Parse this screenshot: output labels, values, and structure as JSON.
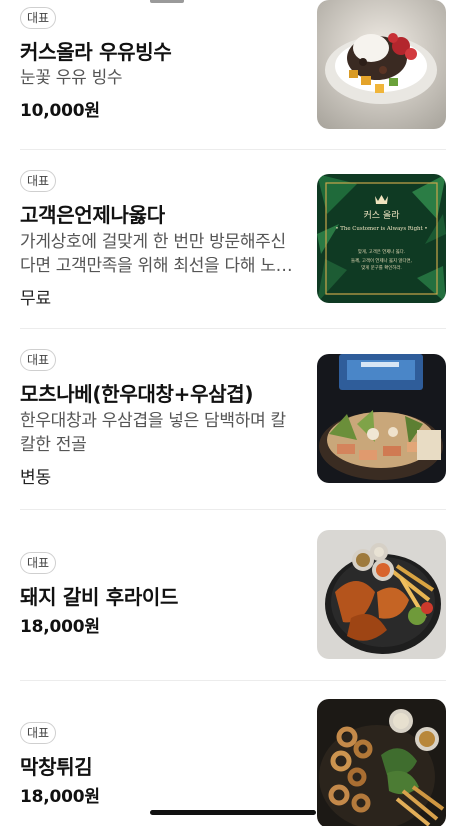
{
  "menu": {
    "items": [
      {
        "badge": "대표",
        "name": "커스올라 우유빙수",
        "description": "눈꽃 우유 빙수",
        "price": "10,000원",
        "image_icon": "bingsu-photo"
      },
      {
        "badge": "대표",
        "name": "고객은언제나옳다",
        "description": "가게상호에 걸맞게 한 번만 방문해주신다면 고객만족을 위해 최선을 다해 노력하겠습니다",
        "price": "무료",
        "image_icon": "customer-card-image",
        "image_text": {
          "brand": "커스 올라",
          "slogan": "• The Customer is Always Right •",
          "line1": "맞게, 고객은 언제나 옳다.",
          "line2": "들께, 고객이 언제나 옳지 않다면,",
          "line3": "맞게 문구를 확인하라."
        }
      },
      {
        "badge": "대표",
        "name": "모츠나베(한우대창+우삼겹)",
        "description": "한우대창과 우삼겹을 넣은 담백하며 칼칼한 전골",
        "price": "변동",
        "image_icon": "hotpot-photo"
      },
      {
        "badge": "대표",
        "name": "돼지 갈비 후라이드",
        "description": "",
        "price": "18,000원",
        "image_icon": "fried-ribs-photo"
      },
      {
        "badge": "대표",
        "name": "막창튀김",
        "description": "",
        "price": "18,000원",
        "image_icon": "fried-makchang-photo"
      }
    ]
  }
}
